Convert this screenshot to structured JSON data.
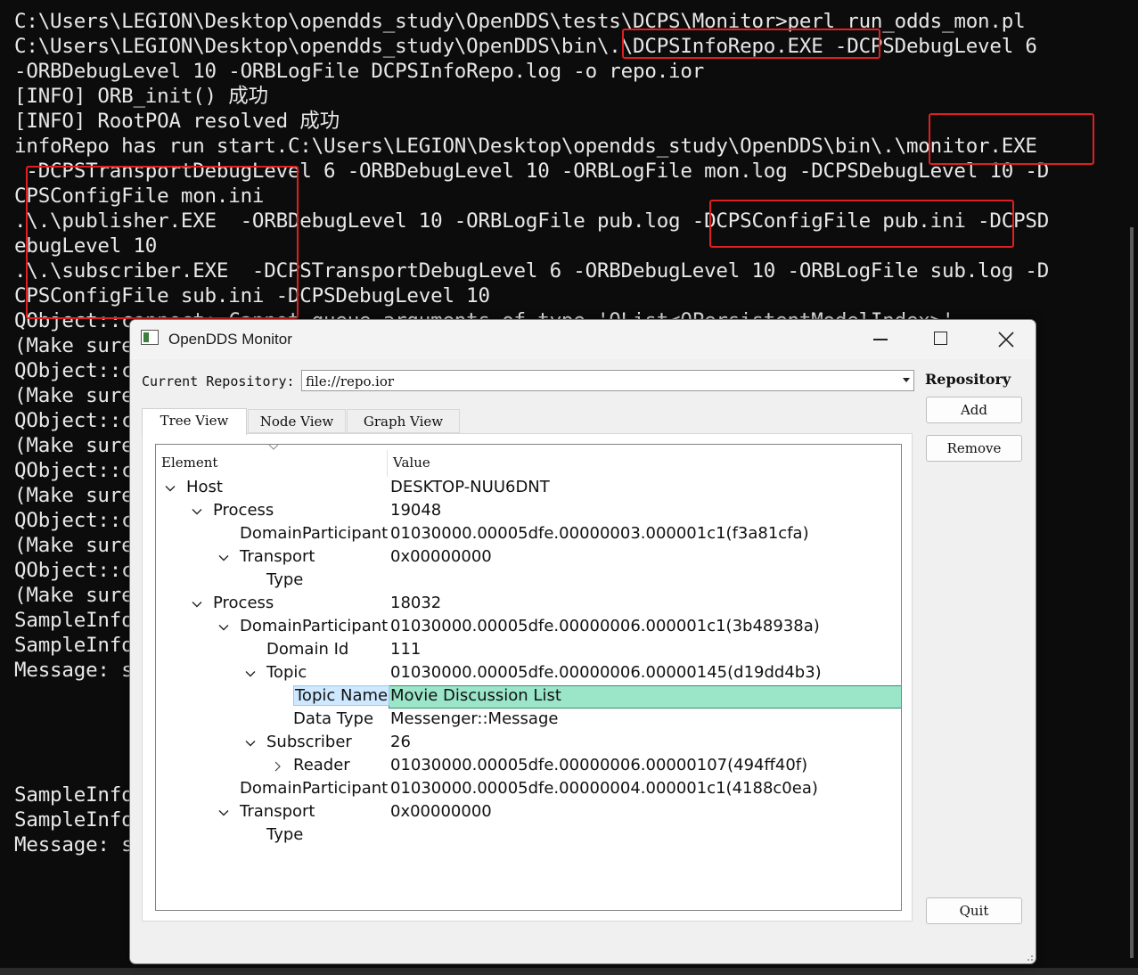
{
  "console": {
    "lines": [
      "C:\\Users\\LEGION\\Desktop\\opendds_study\\OpenDDS\\tests\\DCPS\\Monitor>perl run_odds_mon.pl",
      "C:\\Users\\LEGION\\Desktop\\opendds_study\\OpenDDS\\bin\\.\\DCPSInfoRepo.EXE -DCPSDebugLevel 6",
      "-ORBDebugLevel 10 -ORBLogFile DCPSInfoRepo.log -o repo.ior",
      "[INFO] ORB_init() 成功",
      "[INFO] RootPOA resolved 成功",
      "infoRepo has run start.C:\\Users\\LEGION\\Desktop\\opendds_study\\OpenDDS\\bin\\.\\monitor.EXE",
      " -DCPSTransportDebugLevel 6 -ORBDebugLevel 10 -ORBLogFile mon.log -DCPSDebugLevel 10 -D",
      "CPSConfigFile mon.ini",
      ".\\.\\publisher.EXE  -ORBDebugLevel 10 -ORBLogFile pub.log -DCPSConfigFile pub.ini -DCPSD",
      "ebugLevel 10",
      ".\\.\\subscriber.EXE  -DCPSTransportDebugLevel 6 -ORBDebugLevel 10 -ORBLogFile sub.log -D",
      "CPSConfigFile sub.ini -DCPSDebugLevel 10",
      "QObject::connect: Cannot queue arguments of type 'QList<QPersistentModelIndex>'",
      "(Make sure                                                                          )",
      "QObject::c",
      "(Make sure                                                                          )",
      "QObject::c",
      "(Make sure                                                                          )",
      "QObject::c",
      "(Make sure",
      "QObject::c",
      "(Make sure",
      "QObject::c",
      "(Make sure",
      "SampleInfo",
      "SampleInfo",
      "Message: s",
      "",
      "",
      "",
      "",
      "SampleInfo",
      "SampleInfo",
      "Message: s"
    ]
  },
  "window": {
    "title": "OpenDDS Monitor",
    "repo_label": "Current Repository:",
    "repo_value": "file://repo.ior",
    "repo_group": "Repository",
    "buttons": {
      "add": "Add",
      "remove": "Remove",
      "quit": "Quit"
    },
    "tabs": [
      "Tree View",
      "Node View",
      "Graph View"
    ],
    "tree": {
      "headers": [
        "Element",
        "Value"
      ],
      "rows": [
        {
          "label": "Host",
          "value": "DESKTOP-NUU6DNT",
          "depth": 0,
          "toggle": "expanded"
        },
        {
          "label": "Process",
          "value": "19048",
          "depth": 1,
          "toggle": "expanded"
        },
        {
          "label": "DomainParticipant",
          "value": "01030000.00005dfe.00000003.000001c1(f3a81cfa)",
          "depth": 2,
          "toggle": "none"
        },
        {
          "label": "Transport",
          "value": "0x00000000",
          "depth": 2,
          "toggle": "expanded"
        },
        {
          "label": "Type",
          "value": "",
          "depth": 3,
          "toggle": "none"
        },
        {
          "label": "Process",
          "value": "18032",
          "depth": 1,
          "toggle": "expanded"
        },
        {
          "label": "DomainParticipant",
          "value": "01030000.00005dfe.00000006.000001c1(3b48938a)",
          "depth": 2,
          "toggle": "expanded"
        },
        {
          "label": "Domain Id",
          "value": "111",
          "depth": 3,
          "toggle": "none"
        },
        {
          "label": "Topic",
          "value": "01030000.00005dfe.00000006.00000145(d19dd4b3)",
          "depth": 3,
          "toggle": "expanded"
        },
        {
          "label": "Topic Name",
          "value": "Movie Discussion List",
          "depth": 4,
          "toggle": "none",
          "selected": true
        },
        {
          "label": "Data Type",
          "value": "Messenger::Message",
          "depth": 4,
          "toggle": "none"
        },
        {
          "label": "Subscriber",
          "value": "26",
          "depth": 3,
          "toggle": "expanded"
        },
        {
          "label": "Reader",
          "value": "01030000.00005dfe.00000006.00000107(494ff40f)",
          "depth": 4,
          "toggle": "collapsed"
        },
        {
          "label": "DomainParticipant",
          "value": "01030000.00005dfe.00000004.000001c1(4188c0ea)",
          "depth": 2,
          "toggle": "none"
        },
        {
          "label": "Transport",
          "value": "0x00000000",
          "depth": 2,
          "toggle": "expanded"
        },
        {
          "label": "Type",
          "value": "",
          "depth": 3,
          "toggle": "none"
        }
      ]
    }
  },
  "colors": {
    "console_bg": "#0c0c0c",
    "console_text": "#e8e8e8",
    "highlight_box": "#e02020",
    "selected_value_bg": "#9be6c9",
    "selected_label_bg": "#cde8ff"
  },
  "icons": {
    "app": "app-window-icon",
    "minimize": "minimize-icon",
    "maximize": "maximize-icon",
    "close": "close-icon",
    "expanded": "chevron-down-icon",
    "collapsed": "chevron-right-icon"
  }
}
